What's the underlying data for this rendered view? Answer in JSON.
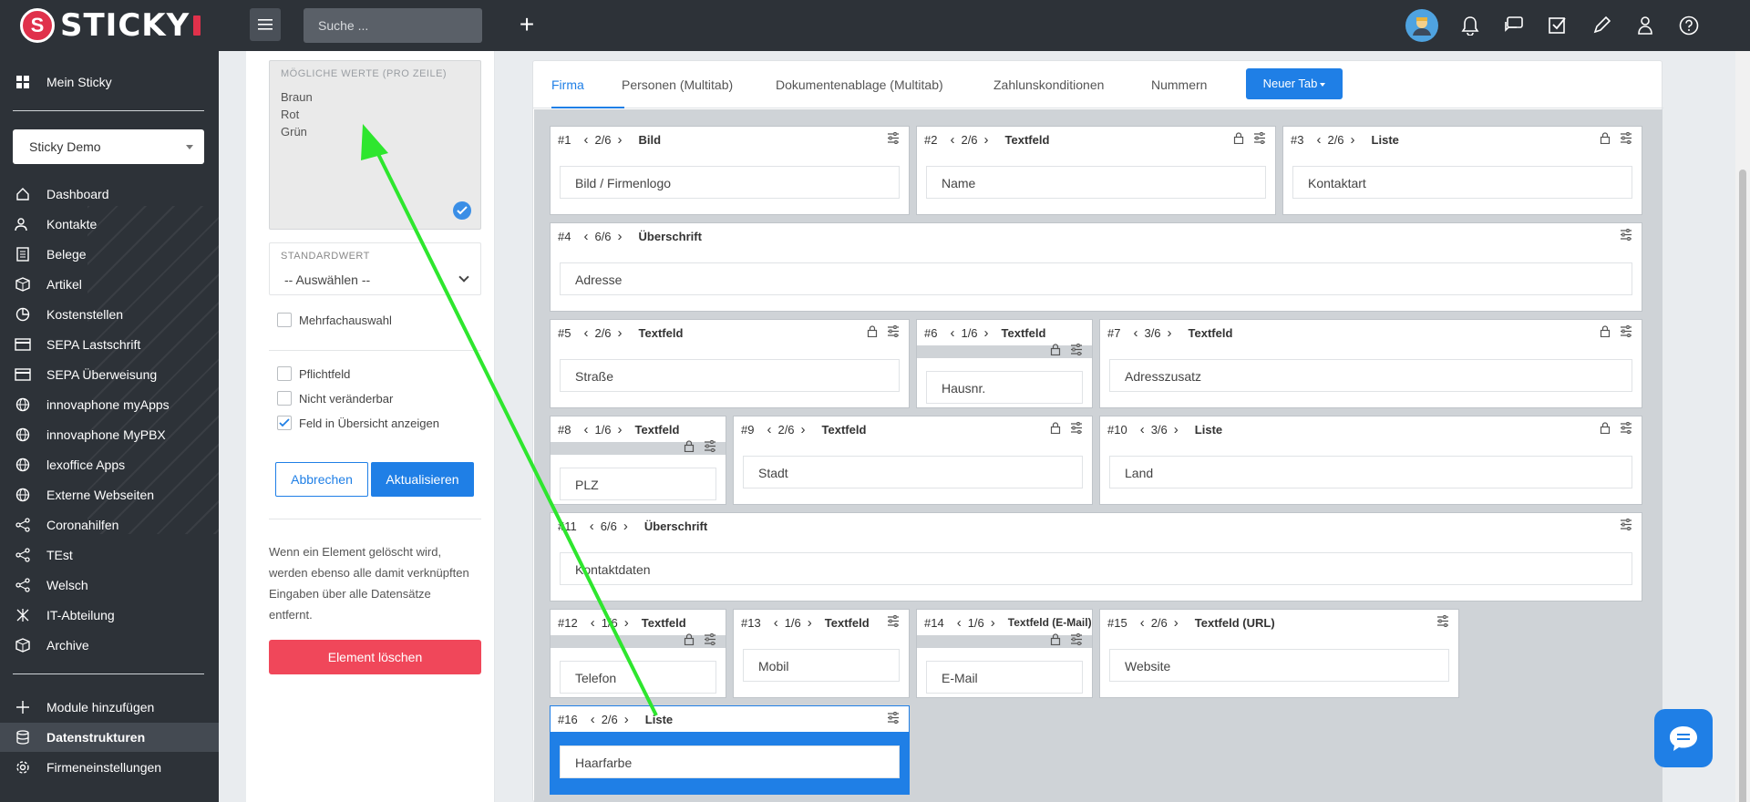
{
  "app": {
    "logo_text": "STICKY"
  },
  "header": {
    "search_placeholder": "Suche ..."
  },
  "sidebar": {
    "top_item": "Mein Sticky",
    "account_select": "Sticky Demo",
    "items": [
      {
        "label": "Dashboard",
        "icon": "home-icon"
      },
      {
        "label": "Kontakte",
        "icon": "contacts-icon"
      },
      {
        "label": "Belege",
        "icon": "document-icon"
      },
      {
        "label": "Artikel",
        "icon": "box-icon"
      },
      {
        "label": "Kostenstellen",
        "icon": "pie-chart-icon"
      },
      {
        "label": "SEPA Lastschrift",
        "icon": "card-icon"
      },
      {
        "label": "SEPA Überweisung",
        "icon": "card-icon"
      },
      {
        "label": "innovaphone myApps",
        "icon": "globe-icon"
      },
      {
        "label": "innovaphone MyPBX",
        "icon": "globe-icon"
      },
      {
        "label": "lexoffice Apps",
        "icon": "globe-icon"
      },
      {
        "label": "Externe Webseiten",
        "icon": "globe-icon"
      },
      {
        "label": "Coronahilfen",
        "icon": "share-icon"
      },
      {
        "label": "TEst",
        "icon": "share-icon"
      },
      {
        "label": "Welsch",
        "icon": "share-icon"
      },
      {
        "label": "IT-Abteilung",
        "icon": "network-icon"
      },
      {
        "label": "Archive",
        "icon": "box-icon"
      }
    ],
    "bottom_items": [
      {
        "label": "Module hinzufügen",
        "icon": "plus-icon"
      },
      {
        "label": "Datenstrukturen",
        "icon": "database-icon"
      },
      {
        "label": "Firmeneinstellungen",
        "icon": "gear-icon"
      }
    ]
  },
  "editor": {
    "values_label": "MÖGLICHE WERTE (PRO ZEILE)",
    "values": [
      "Braun",
      "Rot",
      "Grün"
    ],
    "default_label": "STANDARDWERT",
    "default_value": "-- Auswählen --",
    "multi_select": "Mehrfachauswahl",
    "required": "Pflichtfeld",
    "readonly": "Nicht veränderbar",
    "show_overview": "Feld in Übersicht anzeigen",
    "cancel": "Abbrechen",
    "update": "Aktualisieren",
    "info": "Wenn ein Element gelöscht wird, werden ebenso alle damit verknüpften Eingaben über alle Datensätze entfernt.",
    "delete": "Element löschen"
  },
  "tabs": [
    "Firma",
    "Personen (Multitab)",
    "Dokumentenablage (Multitab)",
    "Zahlunskonditionen",
    "Nummern"
  ],
  "new_tab": "Neuer Tab",
  "fields": [
    {
      "num": "#1",
      "span": "2/6",
      "type": "Bild",
      "value": "Bild / Firmenlogo"
    },
    {
      "num": "#2",
      "span": "2/6",
      "type": "Textfeld",
      "value": "Name"
    },
    {
      "num": "#3",
      "span": "2/6",
      "type": "Liste",
      "value": "Kontaktart"
    },
    {
      "num": "#4",
      "span": "6/6",
      "type": "Überschrift",
      "value": "Adresse"
    },
    {
      "num": "#5",
      "span": "2/6",
      "type": "Textfeld",
      "value": "Straße"
    },
    {
      "num": "#6",
      "span": "1/6",
      "type": "Textfeld",
      "value": "Hausnr."
    },
    {
      "num": "#7",
      "span": "3/6",
      "type": "Textfeld",
      "value": "Adresszusatz"
    },
    {
      "num": "#8",
      "span": "1/6",
      "type": "Textfeld",
      "value": "PLZ"
    },
    {
      "num": "#9",
      "span": "2/6",
      "type": "Textfeld",
      "value": "Stadt"
    },
    {
      "num": "#10",
      "span": "3/6",
      "type": "Liste",
      "value": "Land"
    },
    {
      "num": "#11",
      "span": "6/6",
      "type": "Überschrift",
      "value": "Kontaktdaten"
    },
    {
      "num": "#12",
      "span": "1/6",
      "type": "Textfeld",
      "value": "Telefon"
    },
    {
      "num": "#13",
      "span": "1/6",
      "type": "Textfeld",
      "value": "Mobil"
    },
    {
      "num": "#14",
      "span": "1/6",
      "type": "Textfeld (E-Mail)",
      "value": "E-Mail"
    },
    {
      "num": "#15",
      "span": "2/6",
      "type": "Textfeld (URL)",
      "value": "Website"
    },
    {
      "num": "#16",
      "span": "2/6",
      "type": "Liste",
      "value": "Haarfarbe"
    }
  ],
  "colors": {
    "accent": "#1f7fe6",
    "danger": "#f0475a",
    "annotation_arrow": "#2ee62e"
  }
}
